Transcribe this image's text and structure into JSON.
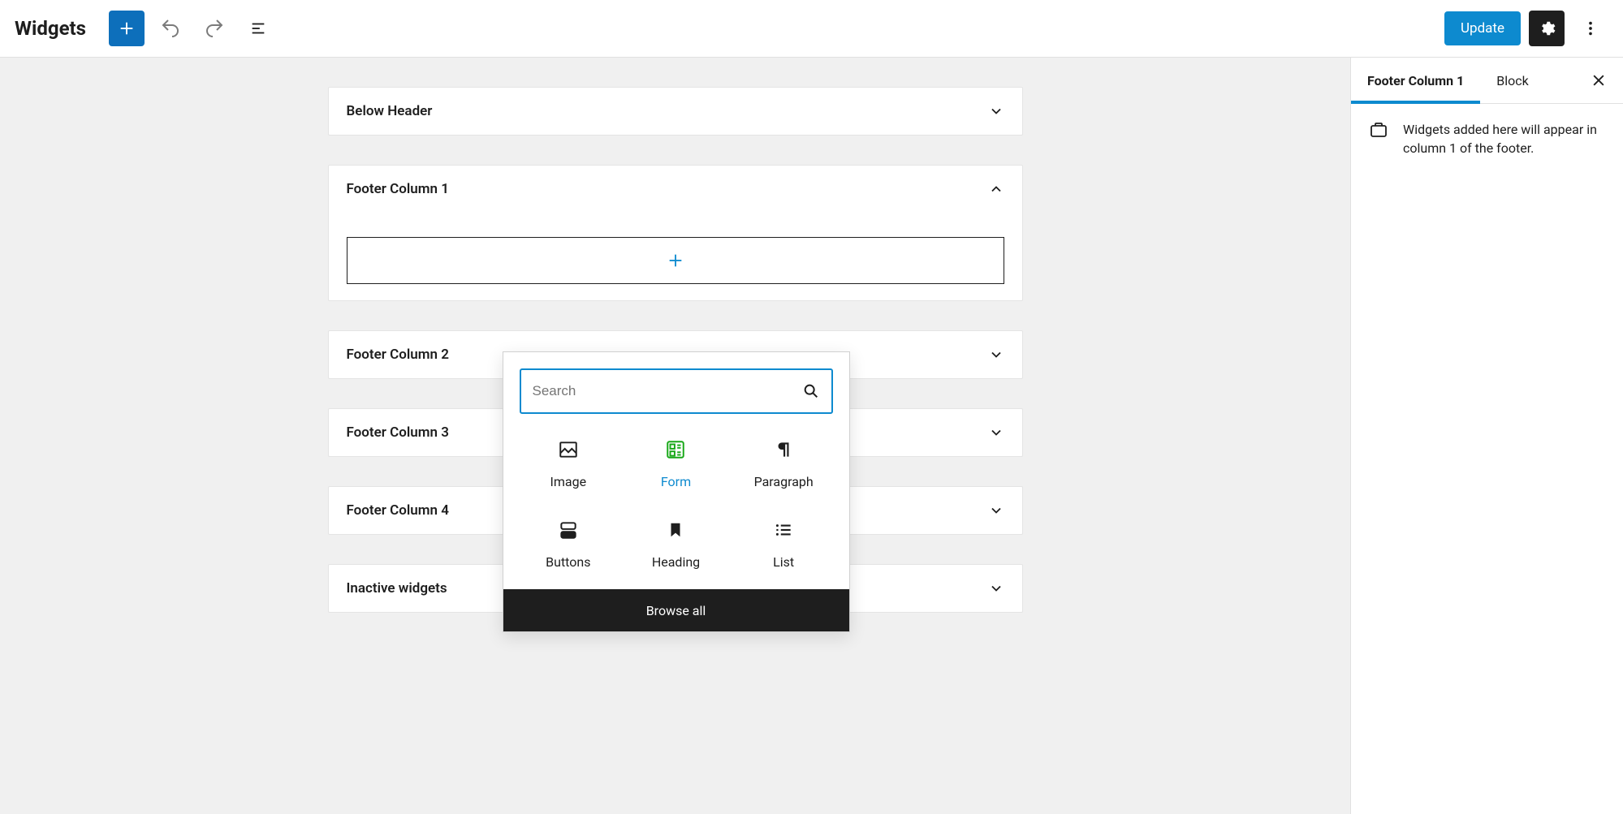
{
  "page_title": "Widgets",
  "toolbar": {
    "update_label": "Update"
  },
  "areas": [
    {
      "title": "Below Header",
      "expanded": false
    },
    {
      "title": "Footer Column 1",
      "expanded": true
    },
    {
      "title": "Footer Column 2",
      "expanded": false
    },
    {
      "title": "Footer Column 3",
      "expanded": false
    },
    {
      "title": "Footer Column 4",
      "expanded": false
    },
    {
      "title": "Inactive widgets",
      "expanded": false
    }
  ],
  "inserter": {
    "search_placeholder": "Search",
    "blocks": [
      {
        "id": "image",
        "label": "Image"
      },
      {
        "id": "form",
        "label": "Form"
      },
      {
        "id": "paragraph",
        "label": "Paragraph"
      },
      {
        "id": "buttons",
        "label": "Buttons"
      },
      {
        "id": "heading",
        "label": "Heading"
      },
      {
        "id": "list",
        "label": "List"
      }
    ],
    "browse_all_label": "Browse all"
  },
  "sidebar": {
    "tabs": [
      {
        "label": "Footer Column 1",
        "active": true
      },
      {
        "label": "Block",
        "active": false
      }
    ],
    "description": "Widgets added here will appear in column 1 of the footer."
  }
}
